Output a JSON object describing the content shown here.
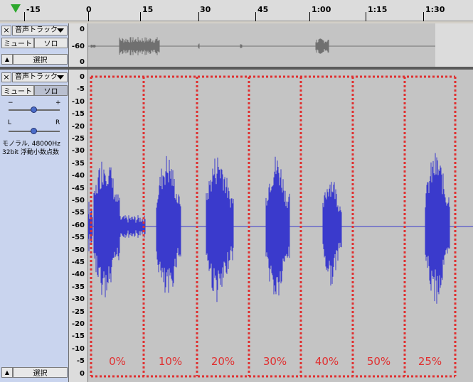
{
  "ruler": {
    "labels": [
      "-15",
      "0",
      "15",
      "30",
      "45",
      "1:00",
      "1:15",
      "1:30"
    ]
  },
  "track1": {
    "name": "音声トラック",
    "mute_label": "ミュート",
    "solo_label": "ソロ",
    "select_label": "選択",
    "scale_labels": [
      "0",
      "-60",
      "0"
    ]
  },
  "track2": {
    "name": "音声トラック",
    "mute_label": "ミュート",
    "solo_label": "ソロ",
    "gain_minus": "−",
    "gain_plus": "+",
    "pan_left": "L",
    "pan_right": "R",
    "info_line1": "モノラル, 48000Hz",
    "info_line2": "32bit 浮動小数点数",
    "select_label": "選択",
    "scale_labels": [
      "0",
      "-5",
      "-10",
      "-15",
      "-20",
      "-25",
      "-30",
      "-35",
      "-40",
      "-45",
      "-50",
      "-55",
      "-60",
      "-55",
      "-50",
      "-45",
      "-40",
      "-35",
      "-30",
      "-25",
      "-20",
      "-15",
      "-10",
      "-5",
      "0"
    ]
  },
  "segments": {
    "labels": [
      "0%",
      "10%",
      "20%",
      "30%",
      "40%",
      "50%",
      "25%"
    ]
  },
  "colors": {
    "waveform": "#3a3acc",
    "overview_wave": "#707070",
    "marker": "#e03030",
    "panel": "#c9d4ee",
    "play_indicator": "#2ea82e"
  },
  "icons": {
    "play_indicator": "triangle-down-icon",
    "close": "close-icon",
    "dropdown": "chevron-down-icon",
    "collapse": "triangle-up-icon"
  }
}
